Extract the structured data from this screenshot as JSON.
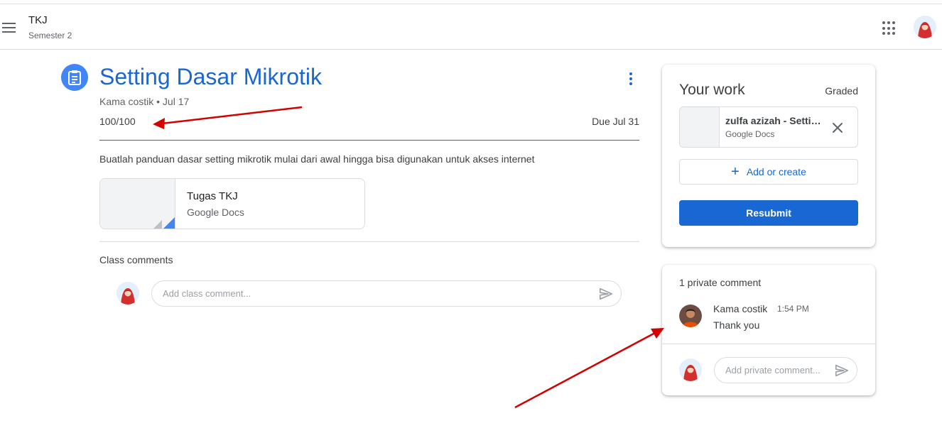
{
  "header": {
    "class_name": "TKJ",
    "class_section": "Semester 2"
  },
  "assignment": {
    "title": "Setting Dasar Mikrotik",
    "meta": "Kama costik • Jul 17",
    "points": "100/100",
    "due": "Due Jul 31",
    "description": "Buatlah panduan dasar setting mikrotik mulai dari awal hingga bisa digunakan untuk akses internet",
    "attachment": {
      "title": "Tugas TKJ",
      "type": "Google Docs"
    }
  },
  "class_comments": {
    "label": "Class comments",
    "placeholder": "Add class comment..."
  },
  "your_work": {
    "title": "Your work",
    "status": "Graded",
    "file": {
      "title": "zulfa azizah - Setting Dasar Mikrotik",
      "type": "Google Docs"
    },
    "add_label": "Add or create",
    "resubmit_label": "Resubmit"
  },
  "private_comments": {
    "header": "1 private comment",
    "comments": [
      {
        "author": "Kama costik",
        "time": "1:54 PM",
        "text": "Thank you"
      }
    ],
    "placeholder": "Add private comment..."
  },
  "colors": {
    "accent": "#1967d2",
    "icon_blue": "#4285f4",
    "annotation": "#d40000"
  },
  "icons": {
    "menu": "hamburger-menu-icon",
    "apps": "apps-grid-icon",
    "assignment": "assignment-icon",
    "more": "more-vert-icon",
    "send": "send-icon",
    "close": "close-icon",
    "add": "plus-icon"
  }
}
